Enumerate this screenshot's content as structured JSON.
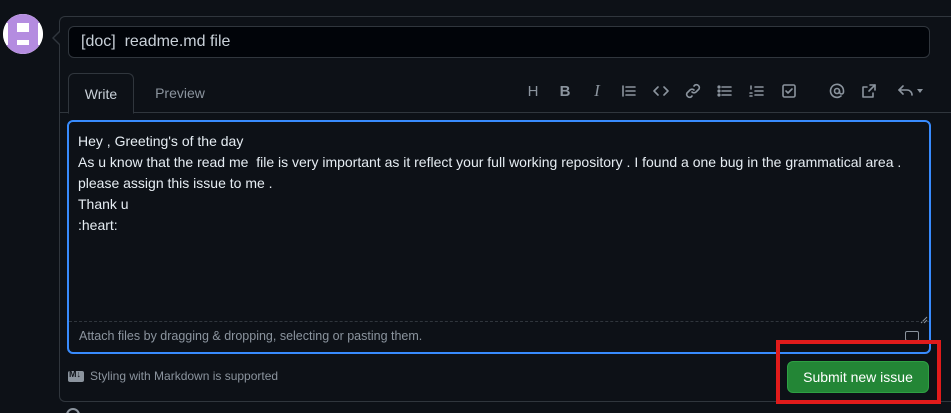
{
  "issue": {
    "title_value": "[doc]  readme.md file"
  },
  "tabs": [
    {
      "label": "Write"
    },
    {
      "label": "Preview"
    }
  ],
  "toolbar": {
    "icons": [
      "heading-icon",
      "bold-icon",
      "italic-icon",
      "quote-icon",
      "code-icon",
      "link-icon",
      "unordered-list-icon",
      "ordered-list-icon",
      "task-list-icon",
      "mention-icon",
      "reference-icon",
      "reply-icon"
    ],
    "heading_glyph": "H",
    "bold_glyph": "B",
    "italic_glyph": "I"
  },
  "editor": {
    "body": "Hey , Greeting's of the day\nAs u know that the read me  file is very important as it reflect your full working repository . I found a one bug in the grammatical area .\nplease assign this issue to me .\nThank u\n:heart:",
    "attach_hint": "Attach files by dragging & dropping, selecting or pasting them."
  },
  "footer": {
    "markdown_note": "Styling with Markdown is supported",
    "submit_label": "Submit new issue"
  },
  "colors": {
    "background": "#0d1117",
    "accent_blue": "#388bfd",
    "submit_green": "#238636",
    "highlight_red": "#e01b1b"
  }
}
